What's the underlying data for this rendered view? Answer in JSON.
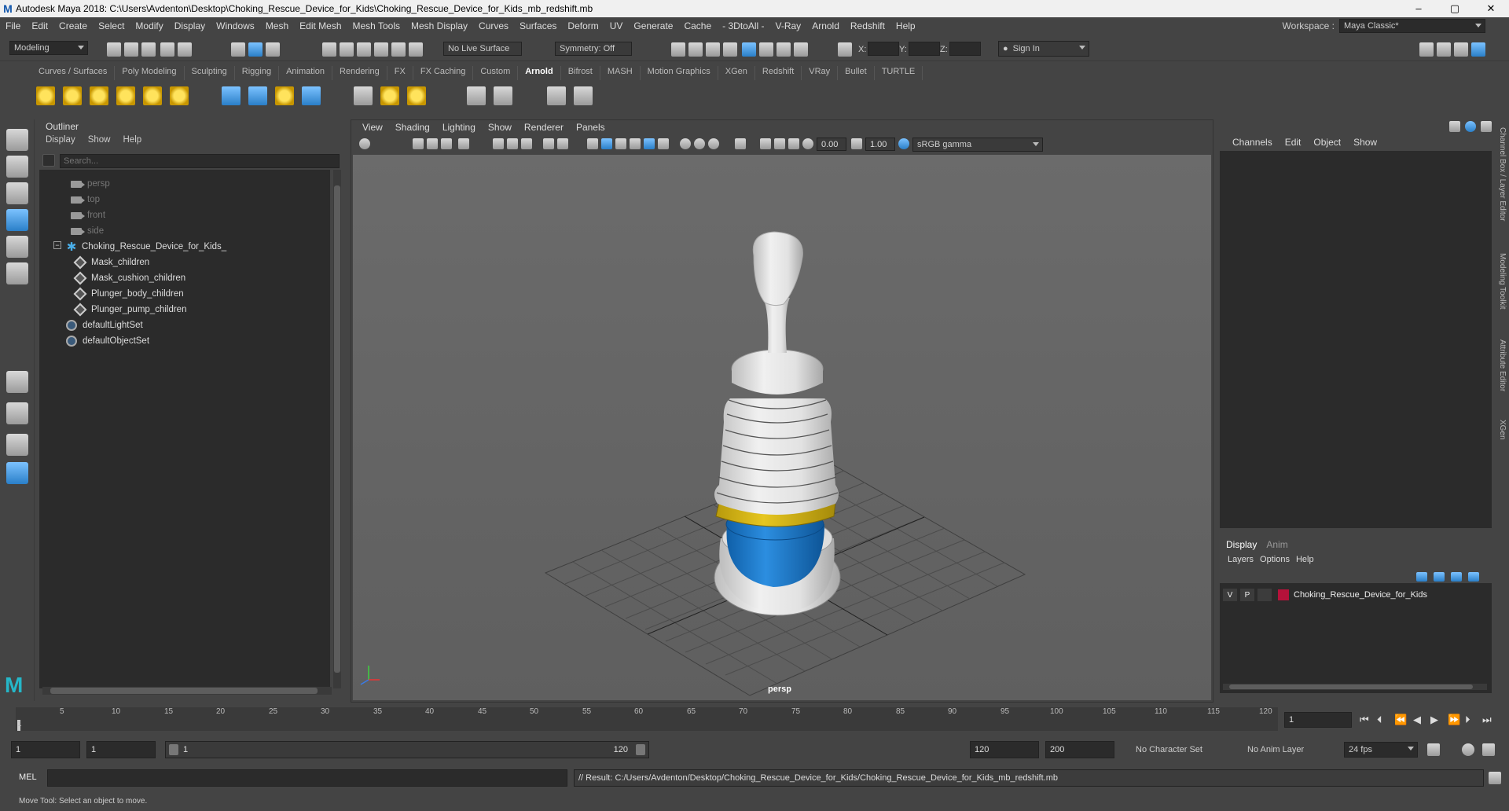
{
  "window": {
    "title": "Autodesk Maya 2018: C:\\Users\\Avdenton\\Desktop\\Choking_Rescue_Device_for_Kids\\Choking_Rescue_Device_for_Kids_mb_redshift.mb",
    "minimize": "–",
    "maximize": "▢",
    "close": "✕"
  },
  "menubar": {
    "items": [
      "File",
      "Edit",
      "Create",
      "Select",
      "Modify",
      "Display",
      "Windows",
      "Mesh",
      "Edit Mesh",
      "Mesh Tools",
      "Mesh Display",
      "Curves",
      "Surfaces",
      "Deform",
      "UV",
      "Generate",
      "Cache",
      "- 3DtoAll -",
      "V-Ray",
      "Arnold",
      "Redshift",
      "Help"
    ],
    "workspace_label": "Workspace :",
    "workspace_value": "Maya Classic*"
  },
  "statusline": {
    "mode": "Modeling",
    "live_surface": "No Live Surface",
    "symmetry": "Symmetry: Off",
    "x_label": "X:",
    "y_label": "Y:",
    "z_label": "Z:",
    "sign_in": "Sign In"
  },
  "shelf": {
    "tabs": [
      "Curves / Surfaces",
      "Poly Modeling",
      "Sculpting",
      "Rigging",
      "Animation",
      "Rendering",
      "FX",
      "FX Caching",
      "Custom",
      "Arnold",
      "Bifrost",
      "MASH",
      "Motion Graphics",
      "XGen",
      "Redshift",
      "VRay",
      "Bullet",
      "TURTLE"
    ],
    "active_tab": "Arnold"
  },
  "outliner": {
    "title": "Outliner",
    "menu": [
      "Display",
      "Show",
      "Help"
    ],
    "search_placeholder": "Search...",
    "items": [
      {
        "label": "persp",
        "icon": "camera-icon"
      },
      {
        "label": "top",
        "icon": "camera-icon"
      },
      {
        "label": "front",
        "icon": "camera-icon"
      },
      {
        "label": "side",
        "icon": "camera-icon"
      },
      {
        "label": "Choking_Rescue_Device_for_Kids_",
        "icon": "group-icon"
      },
      {
        "label": "Mask_children",
        "icon": "mesh-icon"
      },
      {
        "label": "Mask_cushion_children",
        "icon": "mesh-icon"
      },
      {
        "label": "Plunger_body_children",
        "icon": "mesh-icon"
      },
      {
        "label": "Plunger_pump_children",
        "icon": "mesh-icon"
      },
      {
        "label": "defaultLightSet",
        "icon": "set-icon"
      },
      {
        "label": "defaultObjectSet",
        "icon": "set-icon"
      }
    ],
    "expander": "−"
  },
  "viewport": {
    "menu": [
      "View",
      "Shading",
      "Lighting",
      "Show",
      "Renderer",
      "Panels"
    ],
    "exposure": "0.00",
    "gamma": "1.00",
    "colorspace": "sRGB gamma",
    "camera_label": "persp"
  },
  "channelbox": {
    "menu": [
      "Channels",
      "Edit",
      "Object",
      "Show"
    ],
    "layer_tabs": [
      "Display",
      "Anim"
    ],
    "layer_menu": [
      "Layers",
      "Options",
      "Help"
    ],
    "layer": {
      "v": "V",
      "p": "P",
      "name": "Choking_Rescue_Device_for_Kids",
      "color": "#b5123a"
    }
  },
  "sidetabs": [
    "Channel Box / Layer Editor",
    "Modeling Toolkit",
    "Attribute Editor",
    "XGen"
  ],
  "timeline": {
    "ticks": [
      "1",
      "5",
      "10",
      "15",
      "20",
      "25",
      "30",
      "35",
      "40",
      "45",
      "50",
      "55",
      "60",
      "65",
      "70",
      "75",
      "80",
      "85",
      "90",
      "95",
      "100",
      "105",
      "110",
      "115",
      "120"
    ],
    "current_frame": "1"
  },
  "range": {
    "start": "1",
    "playback_start": "1",
    "slider_start": "1",
    "slider_end": "120",
    "playback_end": "120",
    "end": "200",
    "character_set": "No Character Set",
    "anim_layer": "No Anim Layer",
    "fps": "24 fps"
  },
  "cmdline": {
    "lang": "MEL",
    "result": "// Result: C:/Users/Avdenton/Desktop/Choking_Rescue_Device_for_Kids/Choking_Rescue_Device_for_Kids_mb_redshift.mb"
  },
  "helpline": {
    "text": "Move Tool: Select an object to move."
  },
  "colors": {
    "accent": "#4aaee8",
    "pump_yellow": "#d8b614",
    "cushion_blue": "#1a79c9"
  }
}
